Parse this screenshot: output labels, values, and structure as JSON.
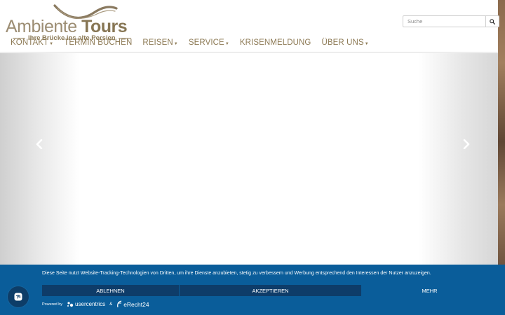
{
  "logo": {
    "name_light": "Ambiente ",
    "name_bold": "Tours",
    "tagline": "Ihre Brücke ins alte Persien"
  },
  "search": {
    "placeholder": "Suche",
    "icon": "search-icon"
  },
  "nav": [
    {
      "label": "KONTAKT",
      "dropdown": true
    },
    {
      "label": "TERMIN BUCHEN",
      "dropdown": false
    },
    {
      "label": "REISEN",
      "dropdown": true
    },
    {
      "label": "SERVICE",
      "dropdown": true
    },
    {
      "label": "KRISENMELDUNG",
      "dropdown": false
    },
    {
      "label": "ÜBER UNS",
      "dropdown": true
    }
  ],
  "slider": {
    "prev_icon": "chevron-left-icon",
    "next_icon": "chevron-right-icon"
  },
  "cookie": {
    "text": "Diese Seite nutzt Website-Tracking-Technologien von Dritten, um ihre Dienste anzubieten, stetig zu verbessern und Werbung entsprechend den Interessen der Nutzer anzuzeigen.",
    "decline_label": "ABLEHNEN",
    "accept_label": "AKZEPTIEREN",
    "more_label": "MEHR",
    "powered_by": "Powered by",
    "usercentrics": "usercentrics",
    "amp": "&",
    "erecht": "eRecht24"
  },
  "colors": {
    "brand_gold": "#8d7a55",
    "cookie_bg": "#0a5d9a",
    "cookie_button": "#0e3c69"
  }
}
